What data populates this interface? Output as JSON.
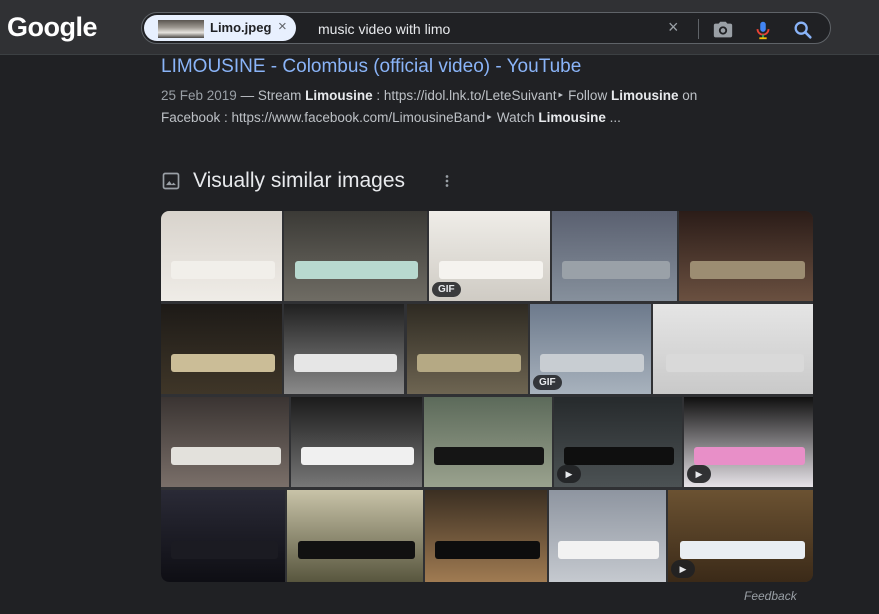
{
  "header": {
    "logo": "Google",
    "chip_label": "Limo.jpeg",
    "chip_close": "×",
    "query": "music video with limo",
    "clear_glyph": "×",
    "icons": [
      "camera-icon",
      "microphone-icon",
      "search-icon"
    ]
  },
  "result": {
    "title": "LIMOUSINE - Colombus (official video) - YouTube",
    "date": "25 Feb 2019",
    "sep": " — ",
    "s1": "Stream ",
    "b1": "Limousine",
    "s2": " : https://idol.lnk.to/LeteSuivant‣ Follow ",
    "b2": "Limousine",
    "s3": " on Facebook : https://www.facebook.com/LimousineBand‣ Watch ",
    "b3": "Limousine",
    "s4": " ..."
  },
  "similar": {
    "title": "Visually similar images",
    "badges": {
      "gif": "GIF",
      "play": "▶"
    },
    "tiles": [
      {
        "name": "image-two-women-by-limo",
        "colors": [
          "#d8d3cc",
          "#efece7"
        ],
        "limo": "#f1efea",
        "badge": ""
      },
      {
        "name": "image-man-green-limo",
        "colors": [
          "#3b3a36",
          "#6f6c64"
        ],
        "limo": "#b8d9cf",
        "badge": ""
      },
      {
        "name": "image-dancer-white-limo",
        "colors": [
          "#efede8",
          "#cfcbc4"
        ],
        "limo": "#f5f3ef",
        "badge": "gif"
      },
      {
        "name": "image-couple-silver-limo",
        "colors": [
          "#5a6070",
          "#86909c"
        ],
        "limo": "#9aa1a8",
        "badge": ""
      },
      {
        "name": "image-man-on-limo-night",
        "colors": [
          "#2b1c18",
          "#6a5040"
        ],
        "limo": "#9c8d72",
        "badge": ""
      },
      {
        "name": "image-woman-red-dress-limo",
        "colors": [
          "#1d1a17",
          "#3f3628"
        ],
        "limo": "#cbbd97",
        "badge": ""
      },
      {
        "name": "image-bw-man-white-limo",
        "colors": [
          "#202020",
          "#8a8a8a"
        ],
        "limo": "#e6e6e6",
        "badge": ""
      },
      {
        "name": "image-gold-limo-garage",
        "colors": [
          "#2e2a22",
          "#6e6552"
        ],
        "limo": "#b5a984",
        "badge": ""
      },
      {
        "name": "image-limo-sky",
        "colors": [
          "#6d7a8c",
          "#a8b2bd"
        ],
        "limo": "#c8cdd2",
        "badge": "gif"
      },
      {
        "name": "image-two-men-suits-limo",
        "colors": [
          "#e5e5e5",
          "#c9c9c9"
        ],
        "limo": "#d9d9d9",
        "badge": ""
      },
      {
        "name": "image-man-party-limo",
        "colors": [
          "#3a3432",
          "#7a6f69"
        ],
        "limo": "#e3e1dc",
        "badge": ""
      },
      {
        "name": "image-white-limo-club",
        "colors": [
          "#1b1b1b",
          "#777777"
        ],
        "limo": "#f0f0f0",
        "badge": ""
      },
      {
        "name": "image-black-limo-street",
        "colors": [
          "#5c6a5a",
          "#9aa28e"
        ],
        "limo": "#151515",
        "badge": ""
      },
      {
        "name": "image-black-limo-garage",
        "colors": [
          "#262a2c",
          "#4c5254"
        ],
        "limo": "#0f0f0f",
        "badge": "play"
      },
      {
        "name": "image-pink-limo",
        "colors": [
          "#101010",
          "#e7e3e8"
        ],
        "limo": "#e88fc8",
        "badge": "play"
      },
      {
        "name": "image-dark-limo-night",
        "colors": [
          "#2a2a36",
          "#0e0e14"
        ],
        "limo": "#1b1b22",
        "badge": ""
      },
      {
        "name": "image-vintage-black-limo",
        "colors": [
          "#c8c3a8",
          "#58563e"
        ],
        "limo": "#111111",
        "badge": ""
      },
      {
        "name": "image-black-limo-lights",
        "colors": [
          "#3b2f22",
          "#a07b52"
        ],
        "limo": "#0d0d0d",
        "badge": ""
      },
      {
        "name": "image-white-limo-trucks",
        "colors": [
          "#8e95a0",
          "#c5c9cf"
        ],
        "limo": "#f2f2f2",
        "badge": ""
      },
      {
        "name": "image-white-limo-road",
        "colors": [
          "#6b5232",
          "#3b2a18"
        ],
        "limo": "#e9eef2",
        "badge": "play"
      }
    ]
  },
  "footer": {
    "feedback": "Feedback"
  }
}
